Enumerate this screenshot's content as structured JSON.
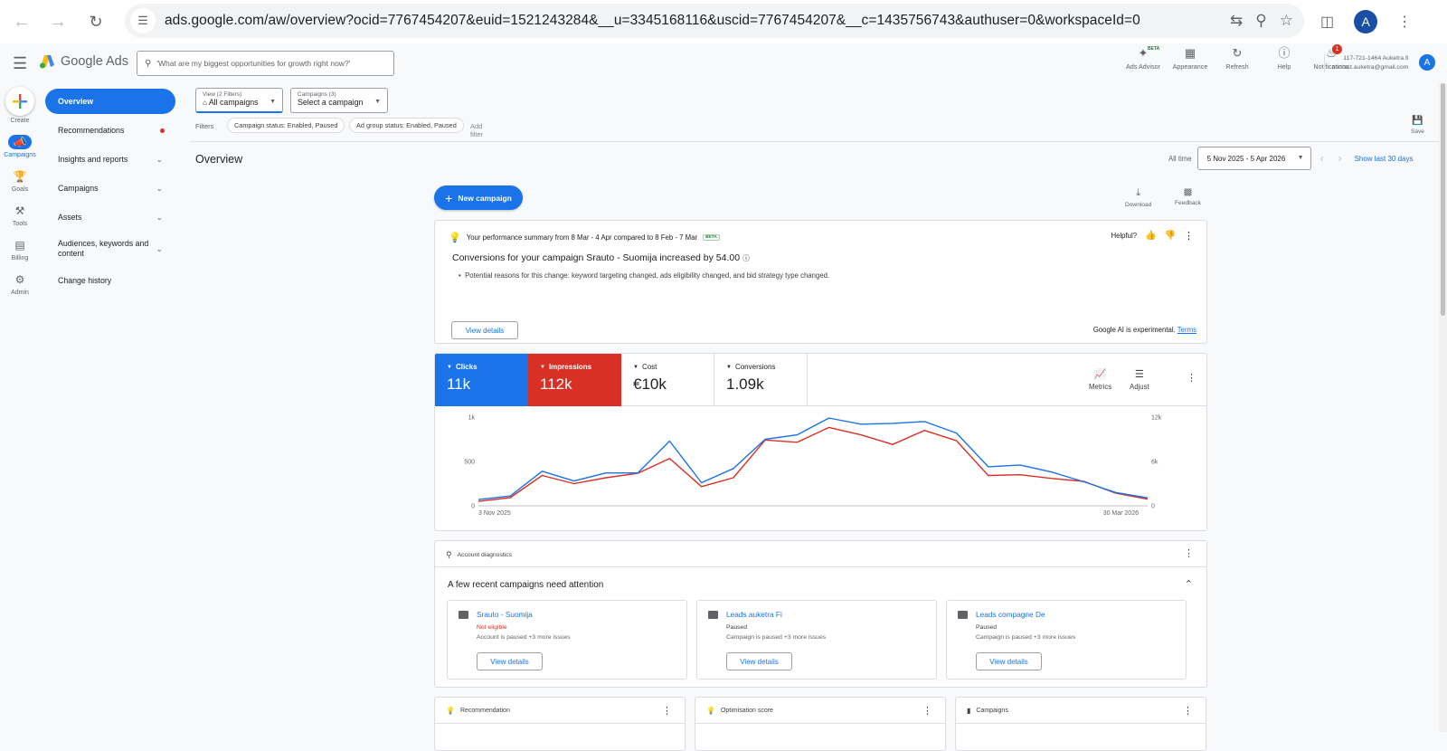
{
  "browser": {
    "url": "ads.google.com/aw/overview?ocid=7767454207&euid=1521243284&__u=3345168116&uscid=7767454207&__c=1435756743&authuser=0&workspaceId=0",
    "profile_initial": "A"
  },
  "appbar": {
    "product_name_1": "Google",
    "product_name_2": "Ads",
    "search_placeholder": "'What are my biggest opportunities for growth right now?'",
    "tools": [
      {
        "label": "Ads Advisor",
        "icon": "sparkle-icon",
        "badge": "BETA"
      },
      {
        "label": "Appearance",
        "icon": "appearance-icon"
      },
      {
        "label": "Refresh",
        "icon": "refresh-icon"
      },
      {
        "label": "Help",
        "icon": "help-icon"
      },
      {
        "label": "Notifications",
        "icon": "bell-icon",
        "count": "1"
      }
    ],
    "account_id": "117-721-1464 Auketra.fi",
    "account_email": "contact.auketra@gmail.com",
    "avatar_initial": "A"
  },
  "rail": {
    "items": [
      {
        "label": "Create",
        "icon": "plus-icon"
      },
      {
        "label": "Campaigns",
        "icon": "megaphone-icon",
        "active": true
      },
      {
        "label": "Goals",
        "icon": "trophy-icon"
      },
      {
        "label": "Tools",
        "icon": "tools-icon"
      },
      {
        "label": "Billing",
        "icon": "card-icon"
      },
      {
        "label": "Admin",
        "icon": "gear-icon"
      }
    ]
  },
  "sidenav": {
    "items": [
      {
        "label": "Overview",
        "active": true
      },
      {
        "label": "Recommendations"
      },
      {
        "label": "Insights and reports"
      },
      {
        "label": "Campaigns"
      },
      {
        "label": "Assets"
      },
      {
        "label": "Audiences, keywords and content"
      },
      {
        "label": "Change history"
      }
    ]
  },
  "filters": {
    "view_label": "View (2 Filters)",
    "view_value": "All campaigns",
    "campaigns_label": "Campaigns (3)",
    "campaigns_value": "Select a campaign",
    "filters_label": "Filters",
    "chips": [
      "Campaign status: Enabled, Paused",
      "Ad group status: Enabled, Paused"
    ],
    "add_filter": "Add filter",
    "save_label": "Save"
  },
  "overview": {
    "title": "Overview",
    "date_range_label": "All time",
    "date_range_value": "5 Nov 2025 - 5 Apr 2026",
    "show_last": "Show last 30 days",
    "new_campaign": "New campaign",
    "download": "Download",
    "feedback": "Feedback"
  },
  "ai_summary": {
    "header": "Your performance summary from 8 Mar - 4 Apr compared to 8 Feb - 7 Mar",
    "beta": "BETA",
    "helpful": "Helpful?",
    "title": "Conversions for your campaign Srauto - Suomija increased by 54.00",
    "bullet": "Potential reasons for this change: keyword targeting changed, ads eligibility changed, and bid strategy type changed.",
    "view_details": "View details",
    "footer": "Google AI is experimental.",
    "terms": "Terms"
  },
  "metrics": [
    {
      "label": "Clicks",
      "value": "11k",
      "color": "#1a73e8"
    },
    {
      "label": "Impressions",
      "value": "112k",
      "color": "#d93025"
    },
    {
      "label": "Cost",
      "value": "€10k"
    },
    {
      "label": "Conversions",
      "value": "1.09k"
    }
  ],
  "metric_tools": {
    "metrics": "Metrics",
    "adjust": "Adjust"
  },
  "chart_data": {
    "type": "line",
    "x": [
      "3 Nov 2025",
      "10 Nov",
      "17 Nov",
      "24 Nov",
      "1 Dec",
      "8 Dec",
      "15 Dec",
      "22 Dec",
      "29 Dec",
      "5 Jan",
      "12 Jan",
      "19 Jan",
      "26 Jan",
      "2 Feb",
      "9 Feb",
      "16 Feb",
      "23 Feb",
      "2 Mar",
      "9 Mar",
      "16 Mar",
      "23 Mar",
      "30 Mar 2026"
    ],
    "x_tick_labels": [
      "3 Nov 2025",
      "30 Mar 2026"
    ],
    "series": [
      {
        "name": "Clicks",
        "axis": "left",
        "color": "#1a73e8",
        "values": [
          70,
          110,
          390,
          280,
          370,
          370,
          730,
          260,
          420,
          750,
          800,
          990,
          920,
          930,
          950,
          820,
          440,
          460,
          380,
          270,
          150,
          90
        ]
      },
      {
        "name": "Impressions",
        "axis": "right",
        "color": "#d93025",
        "values": [
          600,
          1100,
          4100,
          3000,
          3800,
          4400,
          6400,
          2600,
          3800,
          8900,
          8600,
          10600,
          9600,
          8300,
          10200,
          8800,
          4100,
          4200,
          3700,
          3300,
          1700,
          900
        ]
      }
    ],
    "y_left_ticks": [
      "1k",
      "500",
      "0"
    ],
    "y_right_ticks": [
      "12k",
      "6k",
      "0"
    ],
    "y_left_range": [
      0,
      1000
    ],
    "y_right_range": [
      0,
      12000
    ]
  },
  "diagnostics": {
    "header": "Account diagnostics",
    "title": "A few recent campaigns need attention",
    "campaigns": [
      {
        "name": "Srauto - Suomija",
        "status": "Not eligible",
        "error": true,
        "desc": "Account is paused +3 more issues",
        "button": "View details"
      },
      {
        "name": "Leads auketra Fi",
        "status": "Paused",
        "error": false,
        "desc": "Campaign is paused +3 more issues",
        "button": "View details"
      },
      {
        "name": "Leads compagne De",
        "status": "Paused",
        "error": false,
        "desc": "Campaign is paused +3 more issues",
        "button": "View details"
      }
    ]
  },
  "bottom_cards": [
    {
      "title": "Recommendation",
      "icon": "lightbulb-icon"
    },
    {
      "title": "Optimisation score",
      "icon": "lightbulb-icon"
    },
    {
      "title": "Campaigns",
      "icon": "bar-chart-icon"
    }
  ]
}
